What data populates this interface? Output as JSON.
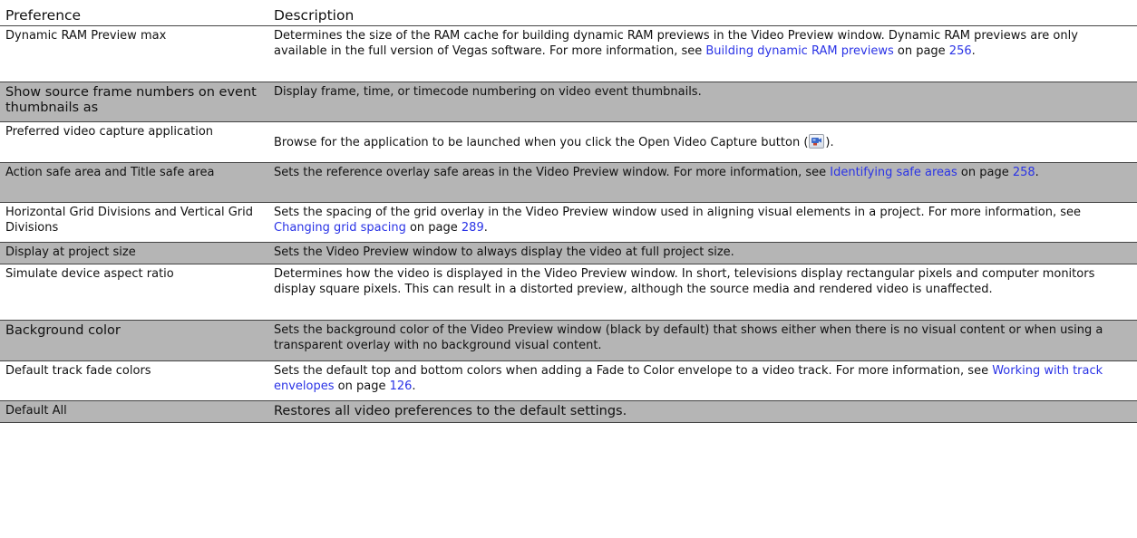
{
  "table": {
    "headers": {
      "preference": "Preference",
      "description": "Description"
    },
    "rows": [
      {
        "preference": "Dynamic RAM Preview max",
        "description": {
          "text1": "Determines the size of the RAM cache for building dynamic RAM previews in the Video Preview window. Dynamic RAM previews are only available in the full version of Vegas software. For more information, see ",
          "link": "Building dynamic RAM previews",
          "text2": " on page ",
          "page": "256",
          "text3": "."
        }
      },
      {
        "preference": "Show source frame numbers on event thumbnails as",
        "description": {
          "text1": "Display frame, time, or timecode numbering on video event thumbnails."
        }
      },
      {
        "preference": "Preferred video capture application",
        "description": {
          "text1": "Browse for the application to be launched when you click the Open Video Capture button (",
          "icon": "video-capture-icon",
          "text2": ")."
        }
      },
      {
        "preference": "Action safe area and Title safe area",
        "description": {
          "text1": "Sets the reference overlay safe areas in the Video Preview window. For more information, see ",
          "link": "Identifying safe areas",
          "text2": " on page ",
          "page": "258",
          "text3": "."
        }
      },
      {
        "preference": "Horizontal Grid Divisions and Vertical Grid Divisions",
        "description": {
          "text1": "Sets the spacing of the grid overlay in the Video Preview window used in aligning visual elements in a project. For more information, see ",
          "link": "Changing grid spacing",
          "text2": " on page ",
          "page": "289",
          "text3": "."
        }
      },
      {
        "preference": "Display at project size",
        "description": {
          "text1": "Sets the Video Preview window to always display the video at full project size."
        }
      },
      {
        "preference": "Simulate device aspect ratio",
        "description": {
          "text1": "Determines how the video is displayed in the Video Preview window. In short, televisions display rectangular pixels and computer monitors display square pixels. This can result in a distorted preview, although the source media and rendered video is unaffected."
        }
      },
      {
        "preference": "Background color",
        "description": {
          "text1": "Sets the background color of the Video Preview window (black by default) that shows either when there is no visual content or when using a transparent overlay with no background visual content."
        }
      },
      {
        "preference": "Default track fade colors",
        "description": {
          "text1": "Sets the default top and bottom colors when adding a Fade to Color envelope to a video track. For more information, see ",
          "link": "Working with track envelopes",
          "text2": " on page ",
          "page": "126",
          "text3": "."
        }
      },
      {
        "preference": "Default All",
        "description": {
          "text1": "Restores all video preferences to the default settings."
        }
      }
    ]
  },
  "colors": {
    "shaded_row": "#b5b5b5",
    "link": "#2a33e6",
    "rule": "#444444"
  }
}
